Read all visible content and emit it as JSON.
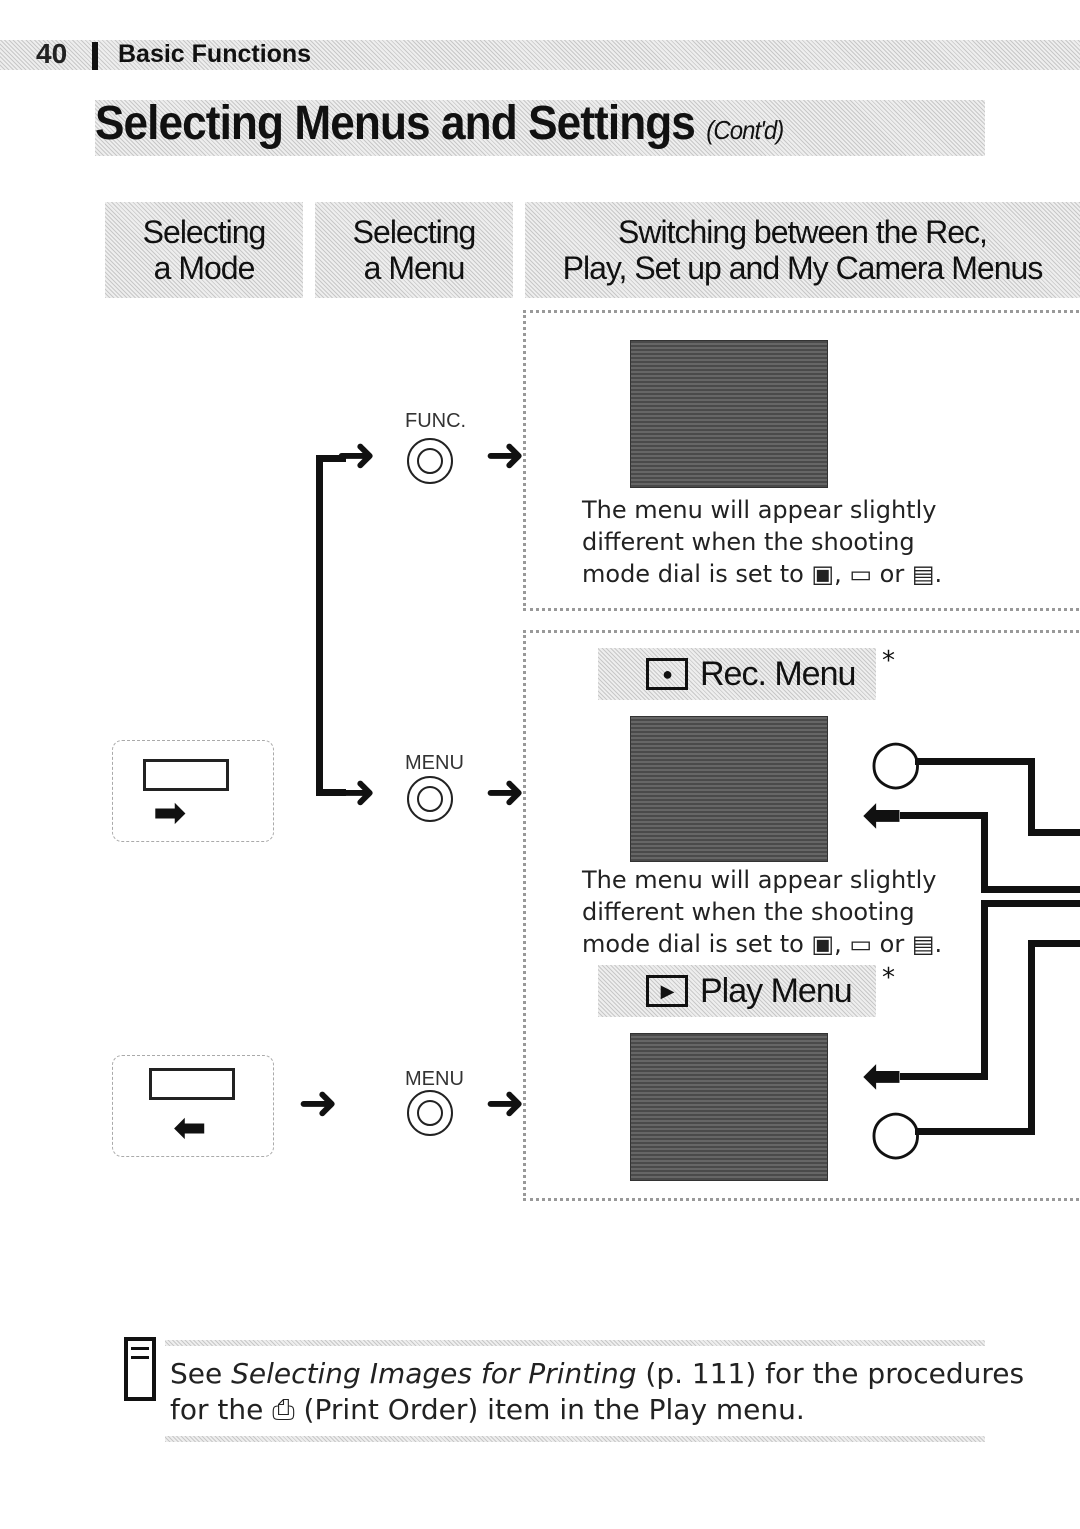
{
  "header": {
    "page_number": "40",
    "section": "Basic Functions"
  },
  "title": {
    "main": "Selecting Menus and Settings",
    "suffix": "(Cont'd)"
  },
  "tabs": [
    {
      "line1": "Selecting",
      "line2": "a Mode"
    },
    {
      "line1": "Selecting",
      "line2": "a Menu"
    },
    {
      "line1": "Switching between the Rec,",
      "line2": "Play, Set up and My Camera Menus"
    }
  ],
  "buttons": {
    "func": "FUNC.",
    "menu1": "MENU",
    "menu2": "MENU"
  },
  "notes": {
    "func_note": [
      "The menu will appear slightly",
      "different when the shooting",
      "mode dial is set to ▣, ▭ or ▤."
    ],
    "rec_note": [
      "The menu will appear slightly",
      "different when the shooting",
      "mode dial is set to ▣, ▭ or ▤."
    ]
  },
  "menus": {
    "rec": {
      "label": "Rec. Menu",
      "asterisk": "*"
    },
    "play": {
      "label": "Play Menu",
      "asterisk": "*"
    }
  },
  "footer": {
    "line1_pre": "See ",
    "line1_italic": "Selecting Images for Printing",
    "line1_post": " (p. 111) for the procedures",
    "line2": "for the ⎙ (Print Order) item in the Play menu."
  }
}
